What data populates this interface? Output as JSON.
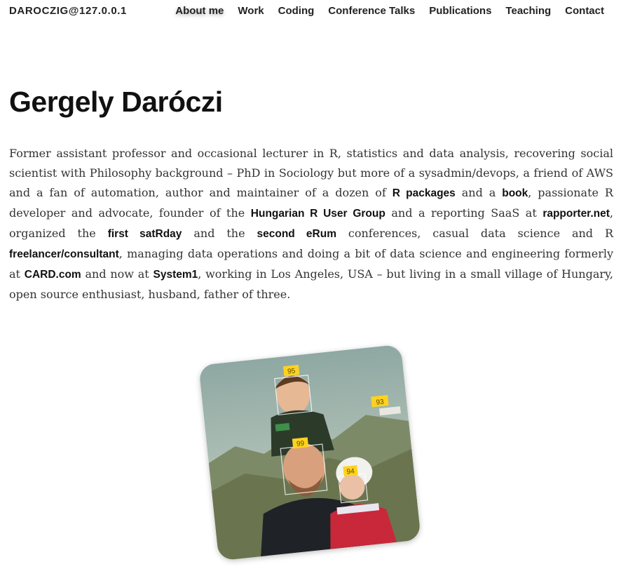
{
  "header": {
    "brand": "DAROCZIG@127.0.0.1",
    "nav": [
      {
        "label": "About me",
        "active": true
      },
      {
        "label": "Work"
      },
      {
        "label": "Coding"
      },
      {
        "label": "Conference Talks"
      },
      {
        "label": "Publications"
      },
      {
        "label": "Teaching"
      },
      {
        "label": "Contact"
      }
    ]
  },
  "main": {
    "title": "Gergely Daróczi",
    "bio": {
      "t1": "Former assistant professor and occasional lecturer in R, statistics and data analysis, recovering social scientist with Philosophy background – PhD in Sociology but more of a sysadmin/devops, a friend of AWS and a fan of automation, author and maintainer of a dozen of ",
      "l1": "R packages",
      "t2": " and a ",
      "l2": "book",
      "t3": ", passionate R developer and advocate, founder of the ",
      "l3": "Hungarian R User Group",
      "t4": " and a reporting SaaS at ",
      "l4": "rapporter.net",
      "t5": ", organized the ",
      "l5": "first satRday",
      "t6": " and the ",
      "l6": "second eRum",
      "t7": " conferences, casual data science and R ",
      "l7": "freelancer/consultant",
      "t8": ", managing data operations and doing a bit of data science and engineering formerly at ",
      "l8": "CARD.com",
      "t9": " and now at ",
      "l9": "System1",
      "t10": ", working in Los Angeles, USA – but living in a small village of Hungary, open source enthusiast, husband, father of three."
    },
    "photo": {
      "face_scores": [
        "95",
        "93",
        "99",
        "94"
      ]
    }
  }
}
